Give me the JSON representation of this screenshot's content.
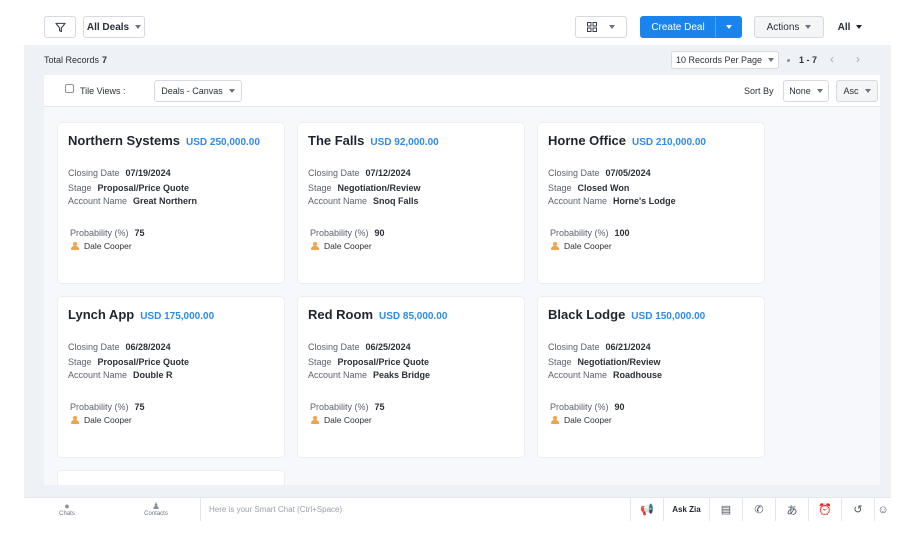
{
  "topbar": {
    "filter_icon": "filter-icon",
    "all_deals": "All Deals",
    "view_icon": "grid-view-icon",
    "create_deal": "Create Deal",
    "actions": "Actions",
    "all": "All"
  },
  "records": {
    "total_label": "Total Records",
    "total_count": "7",
    "per_page": "10 Records Per Page",
    "range": "1 - 7",
    "prev": "‹",
    "next": "›"
  },
  "toolbar": {
    "tile_views": "Tile Views :",
    "canvas": "Deals - Canvas",
    "sort_by": "Sort By",
    "sort_field": "None",
    "sort_order": "Asc"
  },
  "labels": {
    "closing_date": "Closing Date",
    "stage": "Stage",
    "account_name": "Account Name",
    "probability": "Probability (%)"
  },
  "deals": [
    {
      "name": "Northern Systems",
      "amount": "USD 250,000.00",
      "closing_date": "07/19/2024",
      "stage": "Proposal/Price Quote",
      "account": "Great Northern",
      "probability": "75",
      "owner": "Dale Cooper"
    },
    {
      "name": "The Falls",
      "amount": "USD 92,000.00",
      "closing_date": "07/12/2024",
      "stage": "Negotiation/Review",
      "account": "Snoq Falls",
      "probability": "90",
      "owner": "Dale Cooper"
    },
    {
      "name": "Horne Office",
      "amount": "USD 210,000.00",
      "closing_date": "07/05/2024",
      "stage": "Closed Won",
      "account": "Horne's Lodge",
      "probability": "100",
      "owner": "Dale Cooper"
    },
    {
      "name": "Lynch App",
      "amount": "USD 175,000.00",
      "closing_date": "06/28/2024",
      "stage": "Proposal/Price Quote",
      "account": "Double R",
      "probability": "75",
      "owner": "Dale Cooper"
    },
    {
      "name": "Red Room",
      "amount": "USD 85,000.00",
      "closing_date": "06/25/2024",
      "stage": "Proposal/Price Quote",
      "account": "Peaks Bridge",
      "probability": "75",
      "owner": "Dale Cooper"
    },
    {
      "name": "Black Lodge",
      "amount": "USD 150,000.00",
      "closing_date": "06/21/2024",
      "stage": "Negotiation/Review",
      "account": "Roadhouse",
      "probability": "90",
      "owner": "Dale Cooper"
    }
  ],
  "bottombar": {
    "chats": "Chats",
    "contacts": "Contacts",
    "smart_chat_placeholder": "Here is your Smart Chat (Ctrl+Space)",
    "ask_zia": "Ask Zia"
  },
  "colors": {
    "primary": "#1a84ee",
    "amount": "#2f8bea",
    "background": "#eef1f6",
    "owner_icon": "#f0a44a"
  }
}
